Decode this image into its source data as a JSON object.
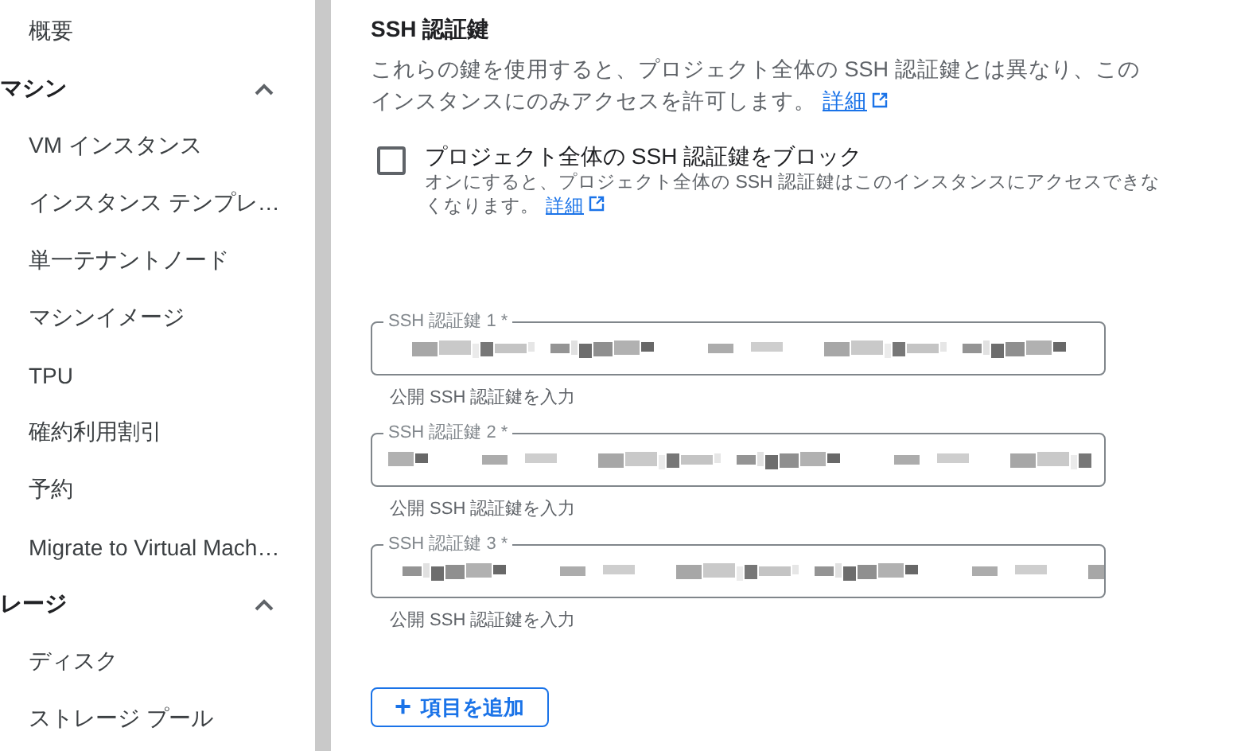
{
  "sidebar": {
    "items": [
      {
        "kind": "item",
        "label": "概要"
      },
      {
        "kind": "section",
        "label": "マシン",
        "expanded": true
      },
      {
        "kind": "item",
        "label": "VM インスタンス"
      },
      {
        "kind": "item",
        "label": "インスタンス テンプレ…"
      },
      {
        "kind": "item",
        "label": "単一テナントノード"
      },
      {
        "kind": "item",
        "label": "マシンイメージ"
      },
      {
        "kind": "item",
        "label": "TPU"
      },
      {
        "kind": "item",
        "label": "確約利用割引"
      },
      {
        "kind": "item",
        "label": "予約"
      },
      {
        "kind": "item",
        "label": "Migrate to Virtual Mach…"
      },
      {
        "kind": "section",
        "label": "レージ",
        "expanded": true
      },
      {
        "kind": "item",
        "label": "ディスク"
      },
      {
        "kind": "item",
        "label": "ストレージ プール"
      }
    ]
  },
  "section": {
    "title": "SSH 認証鍵",
    "description": "これらの鍵を使用すると、プロジェクト全体の SSH 認証鍵とは異なり、このインスタンスにのみアクセスを許可します。",
    "link": "詳細"
  },
  "block_option": {
    "label": "プロジェクト全体の SSH 認証鍵をブロック",
    "checked": false,
    "help": "オンにすると、プロジェクト全体の SSH 認証鍵はこのインスタンスにアクセスできなくなります。",
    "link": "詳細"
  },
  "keys": [
    {
      "label": "SSH 認証鍵 1 *",
      "hint": "公開 SSH 認証鍵を入力"
    },
    {
      "label": "SSH 認証鍵 2 *",
      "hint": "公開 SSH 認証鍵を入力"
    },
    {
      "label": "SSH 認証鍵 3 *",
      "hint": "公開 SSH 認証鍵を入力"
    }
  ],
  "add_button": {
    "icon": "+",
    "label": "項目を追加"
  }
}
